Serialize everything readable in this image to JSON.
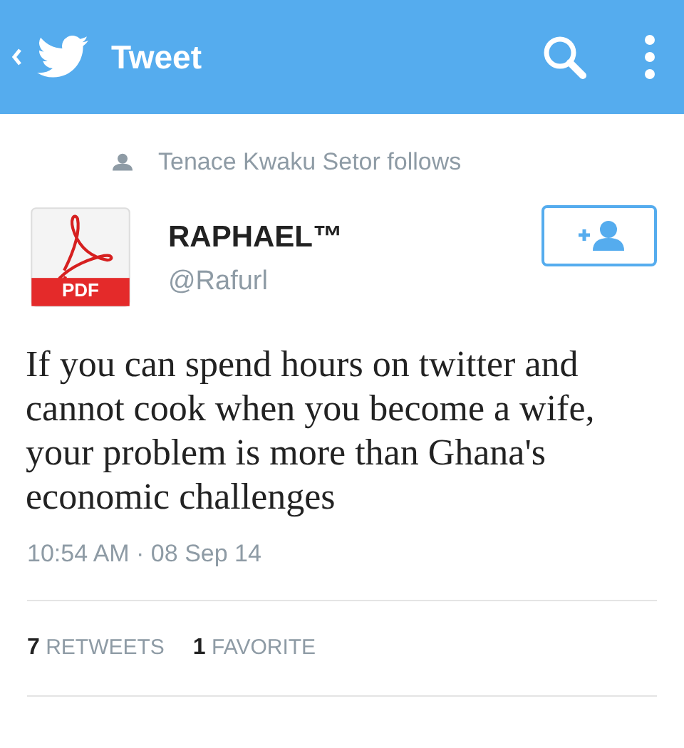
{
  "app_bar": {
    "title": "Tweet"
  },
  "social_context": {
    "text": "Tenace Kwaku Setor follows"
  },
  "author": {
    "name": "RAPHAEL™",
    "handle": "@Rafurl",
    "avatar_label": "PDF"
  },
  "tweet": {
    "text": "If you can spend hours on twitter and cannot cook when you become a wife, your problem is more than Ghana's economic challenges",
    "timestamp": "10:54 AM · 08 Sep 14"
  },
  "stats": [
    {
      "count": "7",
      "label": "RETWEETS"
    },
    {
      "count": "1",
      "label": "FAVORITE"
    }
  ]
}
